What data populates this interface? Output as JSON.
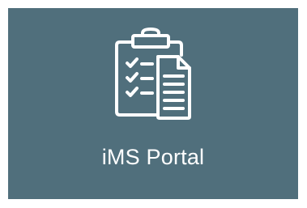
{
  "tile": {
    "label": "iMS Portal",
    "icon": "clipboard-checklist-document-icon",
    "background_color": "#506f7c",
    "text_color": "#ffffff"
  }
}
